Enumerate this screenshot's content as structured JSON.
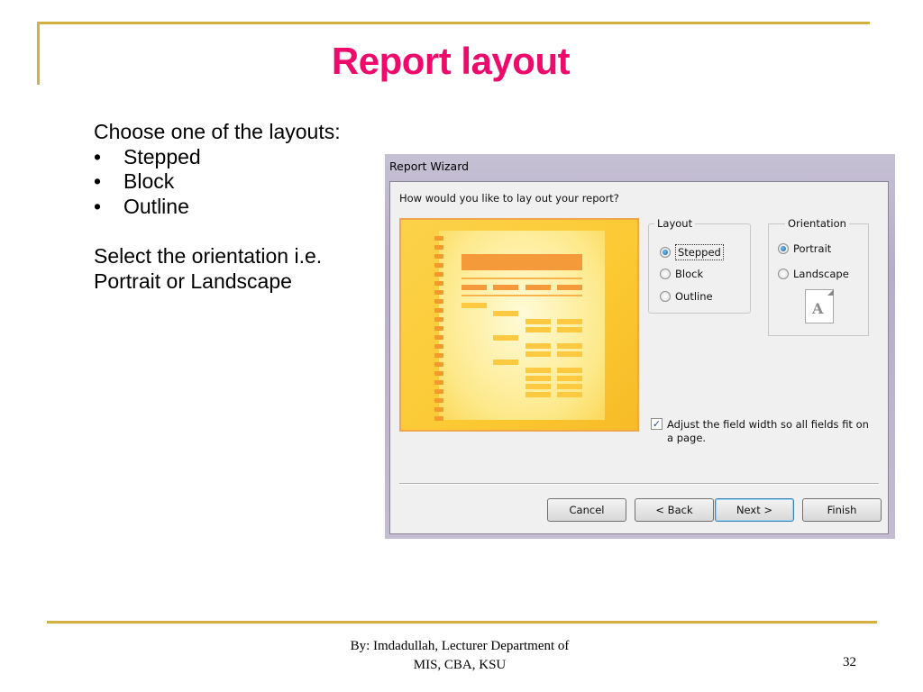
{
  "slide": {
    "title": "Report layout",
    "intro": "Choose one of the layouts:",
    "bullets": [
      "Stepped",
      "Block",
      "Outline"
    ],
    "orientation_line1": "Select the orientation i.e.",
    "orientation_line2": "Portrait or Landscape",
    "bullet_glyph": "•"
  },
  "wizard": {
    "title": "Report Wizard",
    "question": "How would you like to lay out your report?",
    "layout_group": {
      "label": "Layout",
      "options": [
        {
          "label": "Stepped",
          "selected": true
        },
        {
          "label": "Block",
          "selected": false
        },
        {
          "label": "Outline",
          "selected": false
        }
      ]
    },
    "orientation_group": {
      "label": "Orientation",
      "options": [
        {
          "label": "Portrait",
          "selected": true
        },
        {
          "label": "Landscape",
          "selected": false
        }
      ],
      "icon_letter": "A"
    },
    "adjust_checkbox": {
      "checked": true,
      "label": "Adjust the field width so all fields fit on a page.",
      "check_glyph": "✓"
    },
    "buttons": {
      "cancel": "Cancel",
      "back": "< Back",
      "next": "Next >",
      "finish": "Finish"
    }
  },
  "footer": {
    "line1": "By: Imdadullah, Lecturer Department of",
    "line2": "MIS, CBA, KSU",
    "page_number": "32"
  },
  "colors": {
    "title": "#ee0a6a",
    "rule": "#d4b040",
    "preview_border": "#f0a64a"
  }
}
